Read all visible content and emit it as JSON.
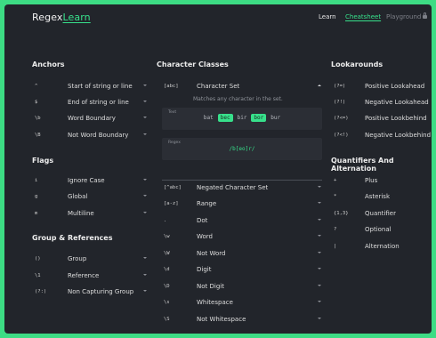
{
  "header": {
    "logo_main": "Regex",
    "logo_accent": "Learn",
    "nav": {
      "learn": "Learn",
      "cheatsheet": "Cheatsheet",
      "playground": "Playground"
    }
  },
  "anchors": {
    "title": "Anchors",
    "items": [
      {
        "code": "^",
        "label": "Start of string or line"
      },
      {
        "code": "$",
        "label": "End of string or line"
      },
      {
        "code": "\\b",
        "label": "Word Boundary"
      },
      {
        "code": "\\B",
        "label": "Not Word Boundary"
      }
    ]
  },
  "flags": {
    "title": "Flags",
    "items": [
      {
        "code": "i",
        "label": "Ignore Case"
      },
      {
        "code": "g",
        "label": "Global"
      },
      {
        "code": "m",
        "label": "Multiline"
      }
    ]
  },
  "groups": {
    "title": "Group & References",
    "items": [
      {
        "code": "()",
        "label": "Group"
      },
      {
        "code": "\\1",
        "label": "Reference"
      },
      {
        "code": "(?:)",
        "label": "Non Capturing Group"
      }
    ]
  },
  "classes": {
    "title": "Character Classes",
    "expanded": {
      "code": "[abc]",
      "label": "Character Set",
      "description": "Matches any character in the set.",
      "text_label": "Text",
      "regex_label": "Regex",
      "example_words": [
        {
          "text": "bat",
          "match": false
        },
        {
          "text": "bec",
          "match": true
        },
        {
          "text": "bir",
          "match": false
        },
        {
          "text": "bor",
          "match": true
        },
        {
          "text": "bur",
          "match": false
        }
      ],
      "regex": "/b[eo]r/"
    },
    "items": [
      {
        "code": "[^abc]",
        "label": "Negated Character Set"
      },
      {
        "code": "[a-z]",
        "label": "Range"
      },
      {
        "code": ".",
        "label": "Dot"
      },
      {
        "code": "\\w",
        "label": "Word"
      },
      {
        "code": "\\W",
        "label": "Not Word"
      },
      {
        "code": "\\d",
        "label": "Digit"
      },
      {
        "code": "\\D",
        "label": "Not Digit"
      },
      {
        "code": "\\s",
        "label": "Whitespace"
      },
      {
        "code": "\\S",
        "label": "Not Whitespace"
      }
    ]
  },
  "lookarounds": {
    "title": "Lookarounds",
    "items": [
      {
        "code": "(?=)",
        "label": "Positive Lookahead"
      },
      {
        "code": "(?!)",
        "label": "Negative Lookahead"
      },
      {
        "code": "(?<=)",
        "label": "Positive Lookbehind"
      },
      {
        "code": "(?<!)",
        "label": "Negative Lookbehind"
      }
    ]
  },
  "quantifiers": {
    "title": "Quantifiers And Alternation",
    "items": [
      {
        "code": "+",
        "label": "Plus"
      },
      {
        "code": "*",
        "label": "Asterisk"
      },
      {
        "code": "{1,3}",
        "label": "Quantifier"
      },
      {
        "code": "?",
        "label": "Optional"
      },
      {
        "code": "|",
        "label": "Alternation"
      }
    ]
  },
  "colors": {
    "accent": "#37e08b",
    "frame": "#3ddc84",
    "background": "#22252b"
  }
}
